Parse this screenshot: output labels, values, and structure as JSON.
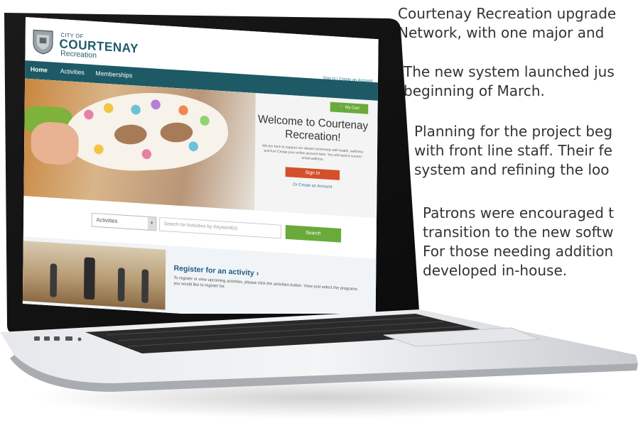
{
  "article": {
    "paragraphs": [
      {
        "lines": [
          "Courtenay Recreation upgrade",
          "Network, with one major and"
        ]
      },
      {
        "lines": [
          "The new system launched jus",
          "beginning of March."
        ]
      },
      {
        "lines": [
          "Planning for the project beg",
          "with front line staff. Their fe",
          "system and refining the loo"
        ]
      },
      {
        "lines": [
          "Patrons were encouraged t",
          "transition to the new softw",
          "For those needing addition",
          "developed in-house."
        ]
      }
    ]
  },
  "site": {
    "logo": {
      "city_of": "CITY OF",
      "name": "COURTENAY",
      "sub": "Recreation"
    },
    "account_links": "Sign In  |  Create an Account",
    "nav": {
      "home": "Home",
      "activities": "Activities",
      "memberships": "Memberships"
    },
    "cart_label": "My Cart",
    "welcome": {
      "title": "Welcome to Courtenay Recreation!",
      "body": "We are here to support our vibrant community with health, wellness and fun! Create your online account here. You will need a current email address.",
      "signin_label": "Sign In",
      "create_label": "Or Create an Account"
    },
    "search": {
      "select_value": "Activities",
      "placeholder": "Search for Activities by Keyword(s)",
      "button_label": "Search"
    },
    "register": {
      "title": "Register for an activity ›",
      "body": "To register or view upcoming activities, please click the activities button. View and select the programs you would like to register for."
    }
  },
  "colors": {
    "nav_bg": "#1d5a66",
    "brand": "#1e5b6b",
    "action_green": "#6aaa3a",
    "signin_orange": "#d4502a",
    "link_blue": "#1e5b8b"
  }
}
